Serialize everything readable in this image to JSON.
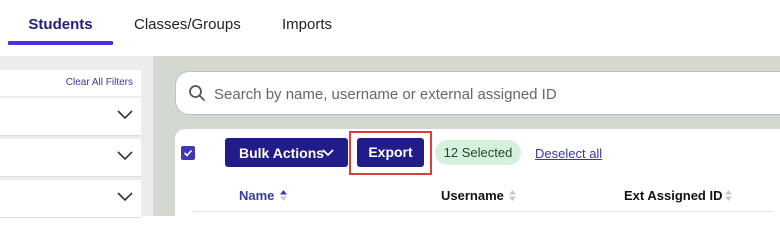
{
  "tabs": [
    {
      "label": "Students",
      "active": true
    },
    {
      "label": "Classes/Groups",
      "active": false
    },
    {
      "label": "Imports",
      "active": false
    }
  ],
  "sidebar": {
    "clear_filters_label": "Clear All Filters",
    "filter_rows": 3
  },
  "search": {
    "placeholder": "Search by name, username or external assigned ID",
    "value": ""
  },
  "toolbar": {
    "bulk_actions_label": "Bulk Actions",
    "export_label": "Export",
    "selected_badge": "12 Selected",
    "deselect_label": "Deselect all",
    "select_all_checked": true
  },
  "table": {
    "columns": [
      "Name",
      "Username",
      "Ext Assigned ID"
    ],
    "sorted_column": "Name"
  },
  "colors": {
    "primary": "#221c8a",
    "tab_underline": "#4d2ee0",
    "highlight_outline": "#e23b3b",
    "badge_bg": "#d6f0dd"
  }
}
